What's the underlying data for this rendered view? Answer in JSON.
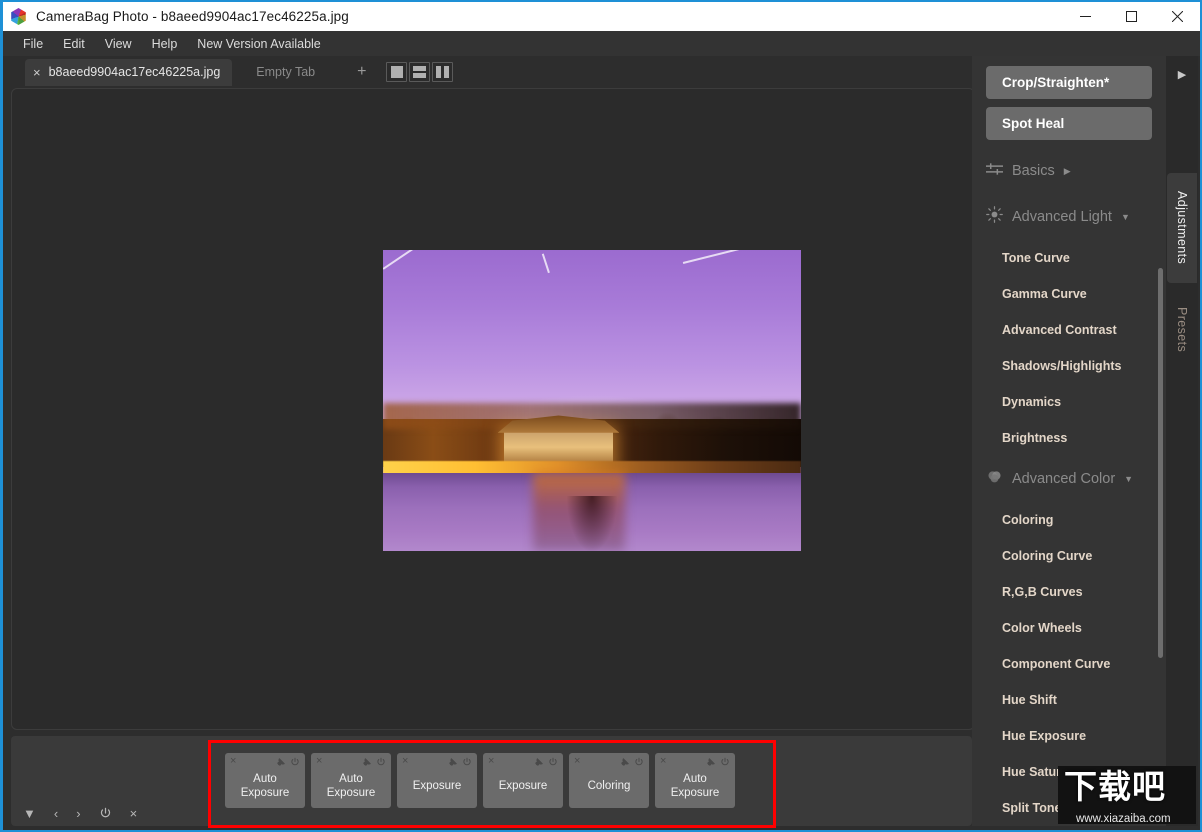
{
  "window": {
    "title": "CameraBag Photo - b8aeed9904ac17ec46225a.jpg",
    "app_icon": "camerabag-cube-icon",
    "minimize": "minimize-icon",
    "maximize": "maximize-icon",
    "close": "close-icon",
    "titlebar_bg": "#ffffff",
    "accent": "#1e90d6"
  },
  "menu": {
    "items": [
      "File",
      "Edit",
      "View",
      "Help",
      "New Version Available"
    ]
  },
  "tabs": {
    "close_glyph": "×",
    "active": "b8aeed9904ac17ec46225a.jpg",
    "empty": "Empty Tab",
    "add": "+",
    "view_modes": [
      "single-view",
      "split-horizontal-view",
      "split-vertical-view"
    ]
  },
  "canvas": {
    "photo_alt": "Forbidden City corner tower at dusk reflected in moat, purple toned",
    "annotation": "red-arrow-pointing-to-history-chips"
  },
  "history": {
    "controls": [
      "▼",
      "‹",
      "›",
      "power-icon",
      "×"
    ],
    "chips": [
      {
        "label": "Auto\nExposure",
        "line1": "Auto",
        "line2": "Exposure"
      },
      {
        "label": "Auto\nExposure",
        "line1": "Auto",
        "line2": "Exposure"
      },
      {
        "label": "Exposure",
        "line1": "Exposure",
        "line2": ""
      },
      {
        "label": "Exposure",
        "line1": "Exposure",
        "line2": ""
      },
      {
        "label": "Coloring",
        "line1": "Coloring",
        "line2": ""
      },
      {
        "label": "Auto\nExposure",
        "line1": "Auto",
        "line2": "Exposure"
      }
    ],
    "chip_icons": {
      "remove": "×",
      "pin": "pin-icon",
      "power": "power-icon"
    },
    "highlight_color": "#ff0000"
  },
  "sidebar": {
    "buttons": [
      {
        "label": "Crop/Straighten*",
        "name": "crop-straighten"
      },
      {
        "label": "Spot Heal",
        "name": "spot-heal"
      }
    ],
    "groups": [
      {
        "label": "Basics",
        "icon": "sliders-icon",
        "expanded": false,
        "caret": "▶",
        "items": []
      },
      {
        "label": "Advanced Light",
        "icon": "sun-icon",
        "expanded": true,
        "caret": "▼",
        "items": [
          "Tone Curve",
          "Gamma Curve",
          "Advanced Contrast",
          "Shadows/Highlights",
          "Dynamics",
          "Brightness"
        ]
      },
      {
        "label": "Advanced Color",
        "icon": "color-drops-icon",
        "expanded": true,
        "caret": "▼",
        "items": [
          "Coloring",
          "Coloring Curve",
          "R,G,B Curves",
          "Color Wheels",
          "Component Curve",
          "Hue Shift",
          "Hue Exposure",
          "Hue Saturation",
          "Split Tone"
        ]
      }
    ],
    "item_color": "#e3d6c8",
    "button_bg": "#6b6b6b"
  },
  "vertical_tabs": {
    "collapse": "▶",
    "items": [
      {
        "label": "Adjustments",
        "active": true
      },
      {
        "label": "Presets",
        "active": false
      }
    ]
  },
  "watermark": {
    "main": "下载吧",
    "sub": "www.xiazaiba.com"
  }
}
